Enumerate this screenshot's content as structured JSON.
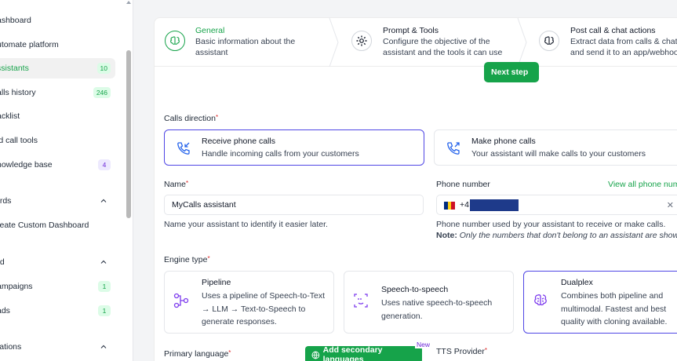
{
  "sidebar": {
    "items": [
      {
        "label": "ashboard",
        "badge": ""
      },
      {
        "label": "utomate platform",
        "badge": ""
      },
      {
        "label": "ssistants",
        "badge": "10"
      },
      {
        "label": "alls history",
        "badge": "246"
      },
      {
        "label": "acklist",
        "badge": ""
      },
      {
        "label": "id call tools",
        "badge": ""
      },
      {
        "label": "nowledge base",
        "badge": "4"
      }
    ],
    "section_boards": "ards",
    "create_dashboard": "reate Custom Dashboard",
    "section_send": "nd",
    "campaigns": {
      "label": "ampaigns",
      "badge": "1"
    },
    "leads": {
      "label": "ads",
      "badge": "1"
    },
    "section_conversations": "sations"
  },
  "steps": [
    {
      "title": "General",
      "desc": "Basic information about the assistant",
      "icon": "brain-icon",
      "active": true
    },
    {
      "title": "Prompt & Tools",
      "desc": "Configure the objective of the assistant and the tools it can use",
      "icon": "gear-icon",
      "active": false
    },
    {
      "title": "Post call & chat actions",
      "desc": "Extract data from calls & chats and send it to an app/webhook",
      "icon": "brain-icon",
      "active": false
    }
  ],
  "next_button": "Next step",
  "calls_direction": {
    "label": "Calls direction",
    "options": [
      {
        "title": "Receive phone calls",
        "desc": "Handle incoming calls from your customers",
        "selected": true
      },
      {
        "title": "Make phone calls",
        "desc": "Your assistant will make calls to your customers",
        "selected": false
      }
    ]
  },
  "name_field": {
    "label": "Name",
    "value": "MyCalls assistant",
    "hint": "Name your assistant to identify it easier later."
  },
  "phone_field": {
    "label": "Phone number",
    "link": "View all phone numbers",
    "prefix": "+4",
    "hint": "Phone number used by your assistant to receive or make calls.",
    "note_label": "Note:",
    "note_text": "Only the numbers that don't belong to an assistant are shown"
  },
  "engine": {
    "label": "Engine type",
    "options": [
      {
        "title": "Pipeline",
        "desc": "Uses a pipeline of Speech-to-Text → LLM → Text-to-Speech to generate responses.",
        "selected": false
      },
      {
        "title": "Speech-to-speech",
        "desc": "Uses native speech-to-speech generation.",
        "selected": false
      },
      {
        "title": "Dualplex",
        "desc": "Combines both pipeline and multimodal. Fastest and best quality with cloning available.",
        "selected": true
      }
    ]
  },
  "primary_language_label": "Primary language",
  "add_secondary_button": "Add secondary languages",
  "new_badge": "New",
  "tts_label": "TTS Provider",
  "colors": {
    "accent": "#16a34a",
    "selected_border": "#4f46e5",
    "flag": [
      "#002b7f",
      "#fcd116",
      "#ce1126"
    ]
  }
}
